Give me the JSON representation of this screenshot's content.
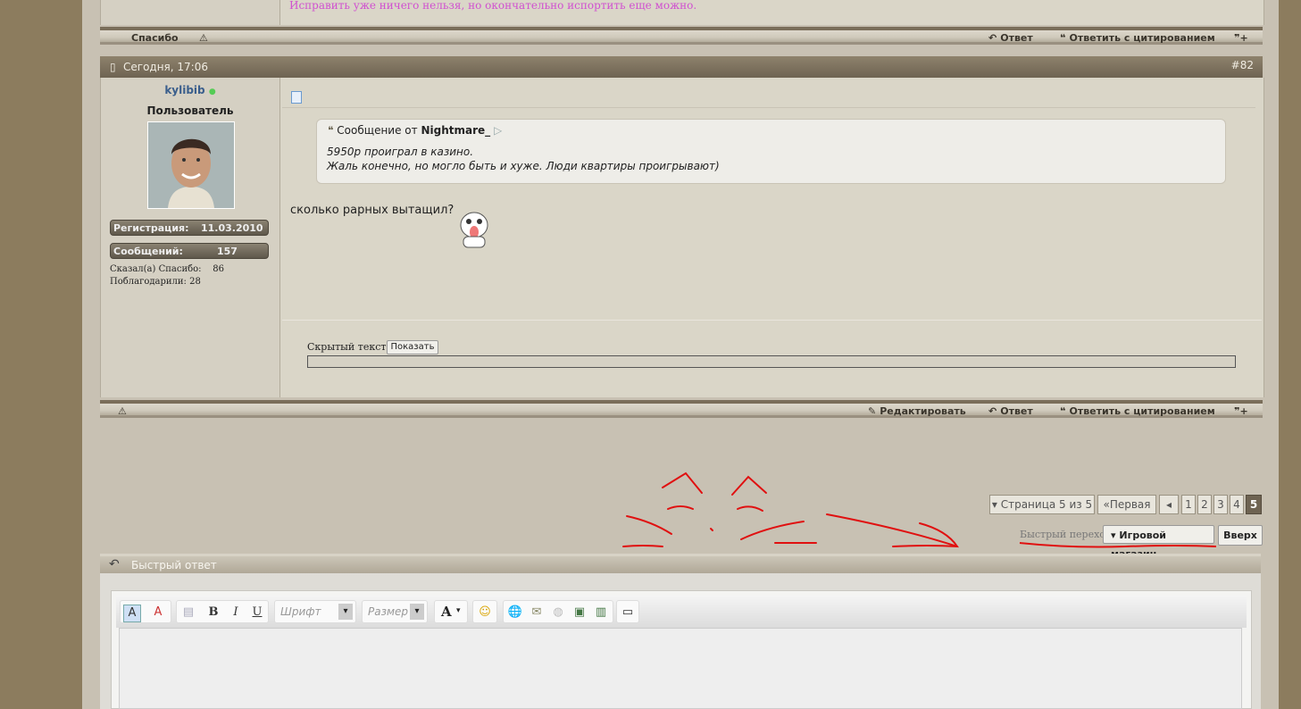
{
  "prev_post": {
    "signature": "Исправить уже ничего нельзя, но окончательно испортить еще можно.",
    "thanks_label": "Спасибо",
    "reply_label": "Ответ",
    "quote_reply_label": "Ответить с цитированием"
  },
  "post": {
    "date": "Сегодня, 17:06",
    "number": "#82",
    "username": "kylibib",
    "user_title": "Пользователь",
    "stats": {
      "reg_label": "Регистрация:",
      "reg_value": "11.03.2010",
      "posts_label": "Сообщений:",
      "posts_value": "157",
      "said_thanks": "Сказал(а) Спасибо:    86",
      "was_thanked": "Поблагодарили: 28"
    },
    "quote": {
      "prefix": "Сообщение от",
      "author": "Nightmare_",
      "line1": "5950р проиграл в казино.",
      "line2": "Жаль конечно, но могло быть и хуже. Люди квартиры проигрывают)"
    },
    "message": "сколько рарных вытащил?",
    "hidden_label": "Скрытый текст:",
    "show_button": "Показать",
    "actions": {
      "edit": "Редактировать",
      "reply": "Ответ",
      "quote_reply": "Ответить с цитированием"
    }
  },
  "pagination": {
    "page_of": "Страница 5 из 5",
    "first": "Первая",
    "pages": [
      "1",
      "2",
      "3",
      "4",
      "5"
    ],
    "current": "5"
  },
  "quick_nav": {
    "label": "Быстрый переход",
    "forum": "Игровой магазин",
    "top": "Вверх"
  },
  "quick_reply": {
    "title": "Быстрый ответ",
    "font_placeholder": "Шрифт",
    "size_placeholder": "Размер"
  },
  "colors": {
    "signature": "#d050d0",
    "username": "#3a5e8c",
    "annotation": "#e01010"
  }
}
